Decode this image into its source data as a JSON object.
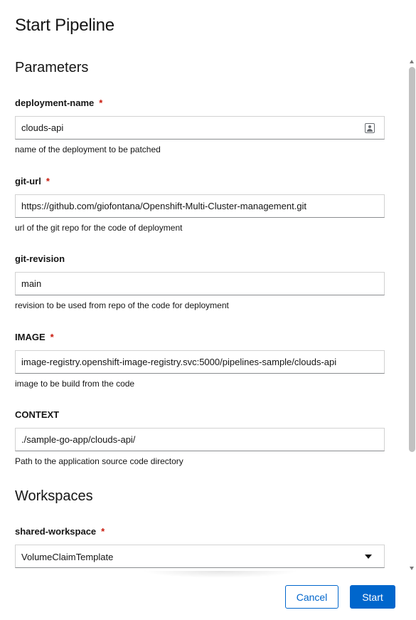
{
  "modal": {
    "title": "Start Pipeline"
  },
  "parameters": {
    "heading": "Parameters",
    "required_marker": "*",
    "fields": [
      {
        "label": "deployment-name",
        "required": true,
        "value": "clouds-api",
        "helper": "name of the deployment to be patched",
        "icon": "id-card-icon"
      },
      {
        "label": "git-url",
        "required": true,
        "value": "https://github.com/giofontana/Openshift-Multi-Cluster-management.git",
        "helper": "url of the git repo for the code of deployment"
      },
      {
        "label": "git-revision",
        "required": false,
        "value": "main",
        "helper": "revision to be used from repo of the code for deployment"
      },
      {
        "label": "IMAGE",
        "required": true,
        "value": "image-registry.openshift-image-registry.svc:5000/pipelines-sample/clouds-api",
        "helper": "image to be build from the code"
      },
      {
        "label": "CONTEXT",
        "required": false,
        "value": "./sample-go-app/clouds-api/",
        "helper": "Path to the application source code directory"
      }
    ]
  },
  "workspaces": {
    "heading": "Workspaces",
    "fields": [
      {
        "label": "shared-workspace",
        "required": true,
        "selected": "VolumeClaimTemplate",
        "icon": "caret-down-icon"
      }
    ]
  },
  "footer": {
    "cancel_label": "Cancel",
    "start_label": "Start"
  },
  "colors": {
    "primary": "#0066cc",
    "required": "#c9190b",
    "text": "#151515",
    "border": "#d2d2d2"
  }
}
